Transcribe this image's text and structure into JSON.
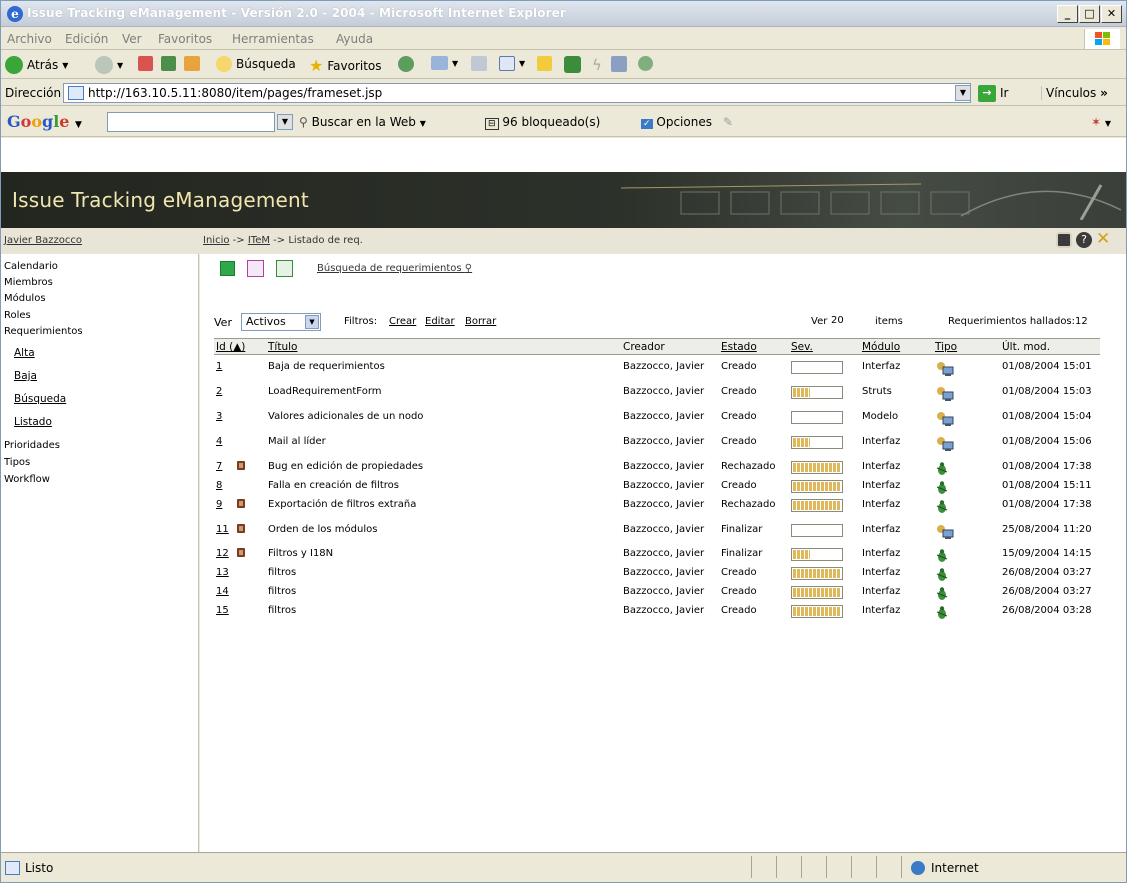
{
  "window": {
    "title": "Issue Tracking eManagement - Versión 2.0 - 2004 - Microsoft Internet Explorer"
  },
  "menu": [
    "Archivo",
    "Edición",
    "Ver",
    "Favoritos",
    "Herramientas",
    "Ayuda"
  ],
  "toolbar": {
    "back": "Atrás",
    "search": "Búsqueda",
    "favorites": "Favoritos"
  },
  "address": {
    "label": "Dirección",
    "url": "http://163.10.5.11:8080/item/pages/frameset.jsp",
    "go": "Ir",
    "links": "Vínculos"
  },
  "google": {
    "logo": "Google",
    "search_web": "Buscar en la Web",
    "blocked": "96 bloqueado(s)",
    "options": "Opciones"
  },
  "app": {
    "title": "Issue Tracking eManagement",
    "user": "Javier Bazzocco",
    "breadcrumb": {
      "home": "Inicio",
      "item": "ITeM",
      "current": "Listado de req.",
      "sep": "->"
    }
  },
  "sidebar": {
    "items": [
      "Calendario",
      "Miembros",
      "Módulos",
      "Roles",
      "Requerimientos"
    ],
    "subitems": [
      "Alta",
      "Baja",
      "Búsqueda",
      "Listado"
    ],
    "items2": [
      "Prioridades",
      "Tipos",
      "Workflow"
    ]
  },
  "content": {
    "search_link": "Búsqueda de requerimientos",
    "filters": {
      "ver_label": "Ver",
      "ver_value": "Activos",
      "filtros_label": "Filtros:",
      "crear": "Crear",
      "editar": "Editar",
      "borrar": "Borrar",
      "ver2_label": "Ver",
      "ver2_value": "20",
      "items_label": "items",
      "found": "Requerimientos hallados:12"
    },
    "headers": [
      "Id (▲)",
      "Título",
      "Creador",
      "Estado",
      "Sev.",
      "Módulo",
      "Tipo",
      "Últ. mod."
    ],
    "rows": [
      {
        "id": "1",
        "lock": false,
        "title": "Baja de requerimientos",
        "creator": "Bazzocco, Javier",
        "state": "Creado",
        "sev": 0.0,
        "module": "Interfaz",
        "type": "computer-icon",
        "date": "01/08/2004 15:01"
      },
      {
        "id": "2",
        "lock": false,
        "title": "LoadRequirementForm",
        "creator": "Bazzocco, Javier",
        "state": "Creado",
        "sev": 0.35,
        "module": "Struts",
        "type": "computer-icon",
        "date": "01/08/2004 15:03"
      },
      {
        "id": "3",
        "lock": false,
        "title": "Valores adicionales de un nodo",
        "creator": "Bazzocco, Javier",
        "state": "Creado",
        "sev": 0.0,
        "module": "Modelo",
        "type": "computer-icon",
        "date": "01/08/2004 15:04"
      },
      {
        "id": "4",
        "lock": false,
        "title": "Mail al líder",
        "creator": "Bazzocco, Javier",
        "state": "Creado",
        "sev": 0.35,
        "module": "Interfaz",
        "type": "computer-icon",
        "date": "01/08/2004 15:06"
      },
      {
        "id": "7",
        "lock": true,
        "title": "Bug en edición de propiedades",
        "creator": "Bazzocco, Javier",
        "state": "Rechazado",
        "sev": 1.0,
        "module": "Interfaz",
        "type": "bug-icon",
        "date": "01/08/2004 17:38"
      },
      {
        "id": "8",
        "lock": false,
        "title": "Falla en creación de filtros",
        "creator": "Bazzocco, Javier",
        "state": "Creado",
        "sev": 1.0,
        "module": "Interfaz",
        "type": "bug-icon",
        "date": "01/08/2004 15:11"
      },
      {
        "id": "9",
        "lock": true,
        "title": "Exportación de filtros extraña",
        "creator": "Bazzocco, Javier",
        "state": "Rechazado",
        "sev": 1.0,
        "module": "Interfaz",
        "type": "bug-icon",
        "date": "01/08/2004 17:38"
      },
      {
        "id": "11",
        "lock": true,
        "title": "Orden de los módulos",
        "creator": "Bazzocco, Javier",
        "state": "Finalizar",
        "sev": 0.0,
        "module": "Interfaz",
        "type": "computer-icon",
        "date": "25/08/2004 11:20"
      },
      {
        "id": "12",
        "lock": true,
        "title": "Filtros y I18N",
        "creator": "Bazzocco, Javier",
        "state": "Finalizar",
        "sev": 0.35,
        "module": "Interfaz",
        "type": "bug-icon",
        "date": "15/09/2004 14:15"
      },
      {
        "id": "13",
        "lock": false,
        "title": "filtros",
        "creator": "Bazzocco, Javier",
        "state": "Creado",
        "sev": 1.0,
        "module": "Interfaz",
        "type": "bug-icon",
        "date": "26/08/2004 03:27"
      },
      {
        "id": "14",
        "lock": false,
        "title": "filtros",
        "creator": "Bazzocco, Javier",
        "state": "Creado",
        "sev": 1.0,
        "module": "Interfaz",
        "type": "bug-icon",
        "date": "26/08/2004 03:27"
      },
      {
        "id": "15",
        "lock": false,
        "title": "filtros",
        "creator": "Bazzocco, Javier",
        "state": "Creado",
        "sev": 1.0,
        "module": "Interfaz",
        "type": "bug-icon",
        "date": "26/08/2004 03:28"
      }
    ]
  },
  "status": {
    "text": "Listo",
    "zone": "Internet"
  }
}
